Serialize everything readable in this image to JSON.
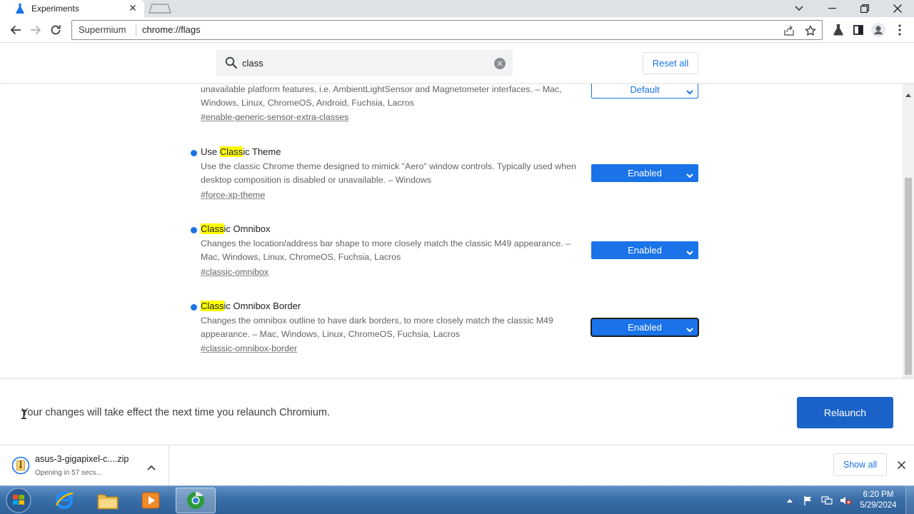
{
  "browser": {
    "tab_title": "Experiments",
    "omnibox_chip": "Supermium",
    "url": "chrome://flags"
  },
  "flags_page": {
    "search_value": "class",
    "reset_label": "Reset all"
  },
  "flags": [
    {
      "name_pre": "",
      "name_mark": "",
      "name_post": "",
      "description": "unavailable platform features, i.e. AmbientLightSensor and Magnetometer interfaces. – Mac, Windows, Linux, ChromeOS, Android, Fuchsia, Lacros",
      "link": "#enable-generic-sensor-extra-classes",
      "value": "Default"
    },
    {
      "name_pre": "Use ",
      "name_mark": "Class",
      "name_post": "ic Theme",
      "description": "Use the classic Chrome theme designed to mimick \"Aero\" window controls. Typically used when desktop composition is disabled or unavailable. – Windows",
      "link": "#force-xp-theme",
      "value": "Enabled"
    },
    {
      "name_pre": "",
      "name_mark": "Class",
      "name_post": "ic Omnibox",
      "description": "Changes the location/address bar shape to more closely match the classic M49 appearance. – Mac, Windows, Linux, ChromeOS, Fuchsia, Lacros",
      "link": "#classic-omnibox",
      "value": "Enabled"
    },
    {
      "name_pre": "",
      "name_mark": "Class",
      "name_post": "ic Omnibox Border",
      "description": "Changes the omnibox outline to have dark borders, to more closely match the classic M49 appearance. – Mac, Windows, Linux, ChromeOS, Fuchsia, Lacros",
      "link": "#classic-omnibox-border",
      "value": "Enabled"
    }
  ],
  "relaunch": {
    "message": "Your changes will take effect the next time you relaunch Chromium.",
    "button_label": "Relaunch"
  },
  "downloads": {
    "file_name": "asus-3-gigapixel-c....zip",
    "status": "Opening in 57 secs...",
    "show_all_label": "Show all"
  },
  "taskbar": {
    "time": "6:20 PM",
    "date": "5/29/2024"
  },
  "colors": {
    "accent": "#1a73e8",
    "highlight": "#ffff00",
    "taskbar": "#3b6fa9"
  }
}
